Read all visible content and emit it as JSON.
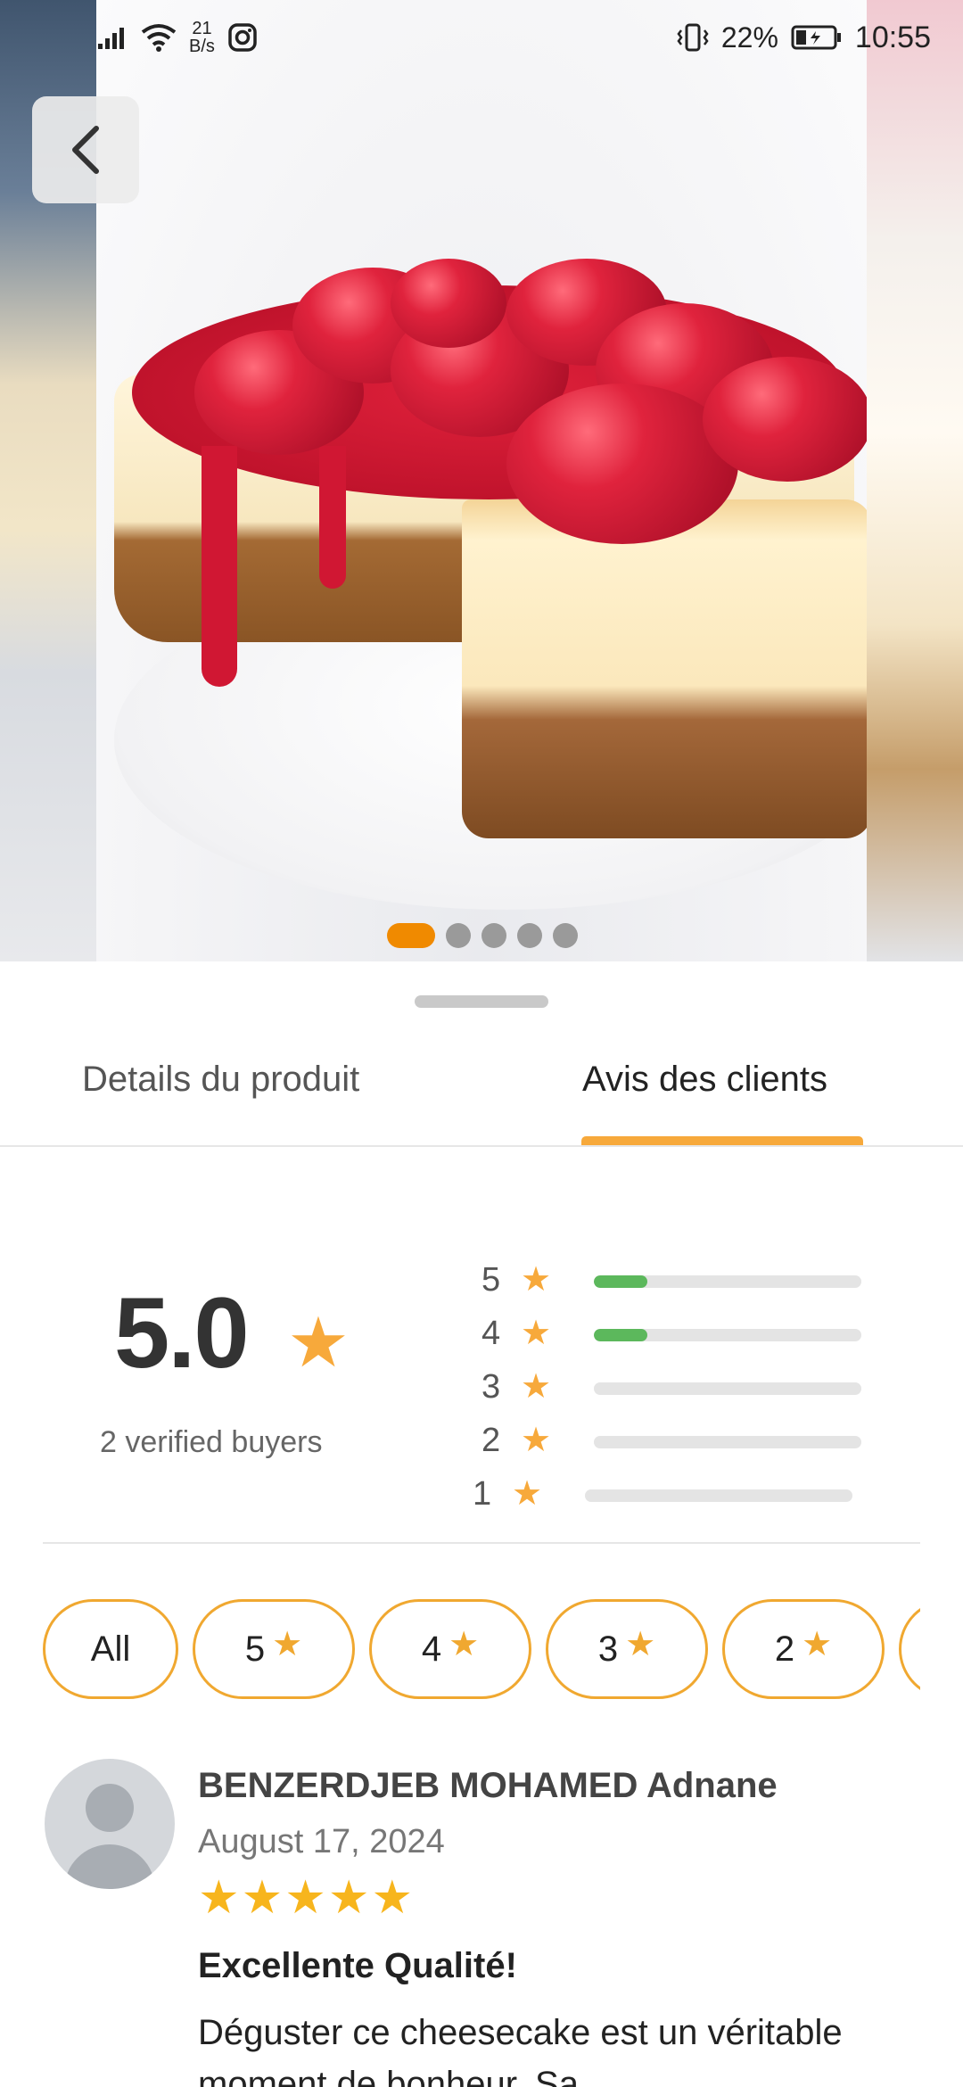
{
  "status_bar": {
    "net_rate_value": "21",
    "net_rate_unit": "B/s",
    "battery": "22%",
    "time": "10:55",
    "icons": [
      "signal-icon",
      "wifi-icon",
      "instagram-icon",
      "vibrate-icon",
      "battery-icon"
    ]
  },
  "carousel": {
    "slide_count": 5,
    "active_index": 0
  },
  "tabs": [
    {
      "label": "Details du produit",
      "active": false
    },
    {
      "label": "Avis des clients",
      "active": true
    }
  ],
  "rating_summary": {
    "average": "5.0",
    "verified_label": "2 verified buyers",
    "distribution": [
      {
        "stars": "5",
        "fraction": 0.2
      },
      {
        "stars": "4",
        "fraction": 0.2
      },
      {
        "stars": "3",
        "fraction": 0
      },
      {
        "stars": "2",
        "fraction": 0
      },
      {
        "stars": "1",
        "fraction": 0
      }
    ]
  },
  "filters": {
    "all_label": "All",
    "star_options": [
      "5",
      "4",
      "3",
      "2"
    ]
  },
  "review": {
    "author": "BENZERDJEB MOHAMED Adnane",
    "date": "August 17, 2024",
    "stars": "★★★★★",
    "title": "Excellente Qualité!",
    "text": "Déguster ce cheesecake est un véritable moment de bonheur. Sa"
  },
  "colors": {
    "accent": "#f7a93b",
    "bar_fill": "#5cb85c",
    "indicator_active": "#f08a00"
  }
}
